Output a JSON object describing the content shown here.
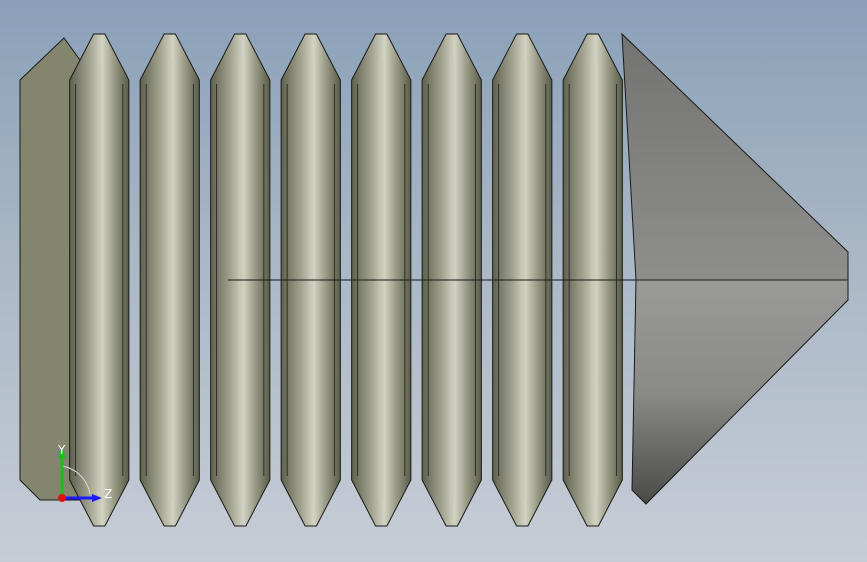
{
  "viewport": {
    "background_top": "#8aa0b8",
    "background_bottom": "#c6cdd6"
  },
  "model": {
    "kind": "cone-point-set-screw",
    "thread_turns_visible": 8,
    "body_color": "#8f917f",
    "crest_color": "#c9c9b8",
    "root_color": "#6d6f5c",
    "point_color": "#8a8a88",
    "edge_color": "#1a1a16"
  },
  "triad": {
    "icon": "xyz-axis-triad-icon",
    "y_label": "Y",
    "z_label": "Z",
    "y_color": "#18c018",
    "z_color": "#1a1aff",
    "x_color": "#e01010"
  }
}
